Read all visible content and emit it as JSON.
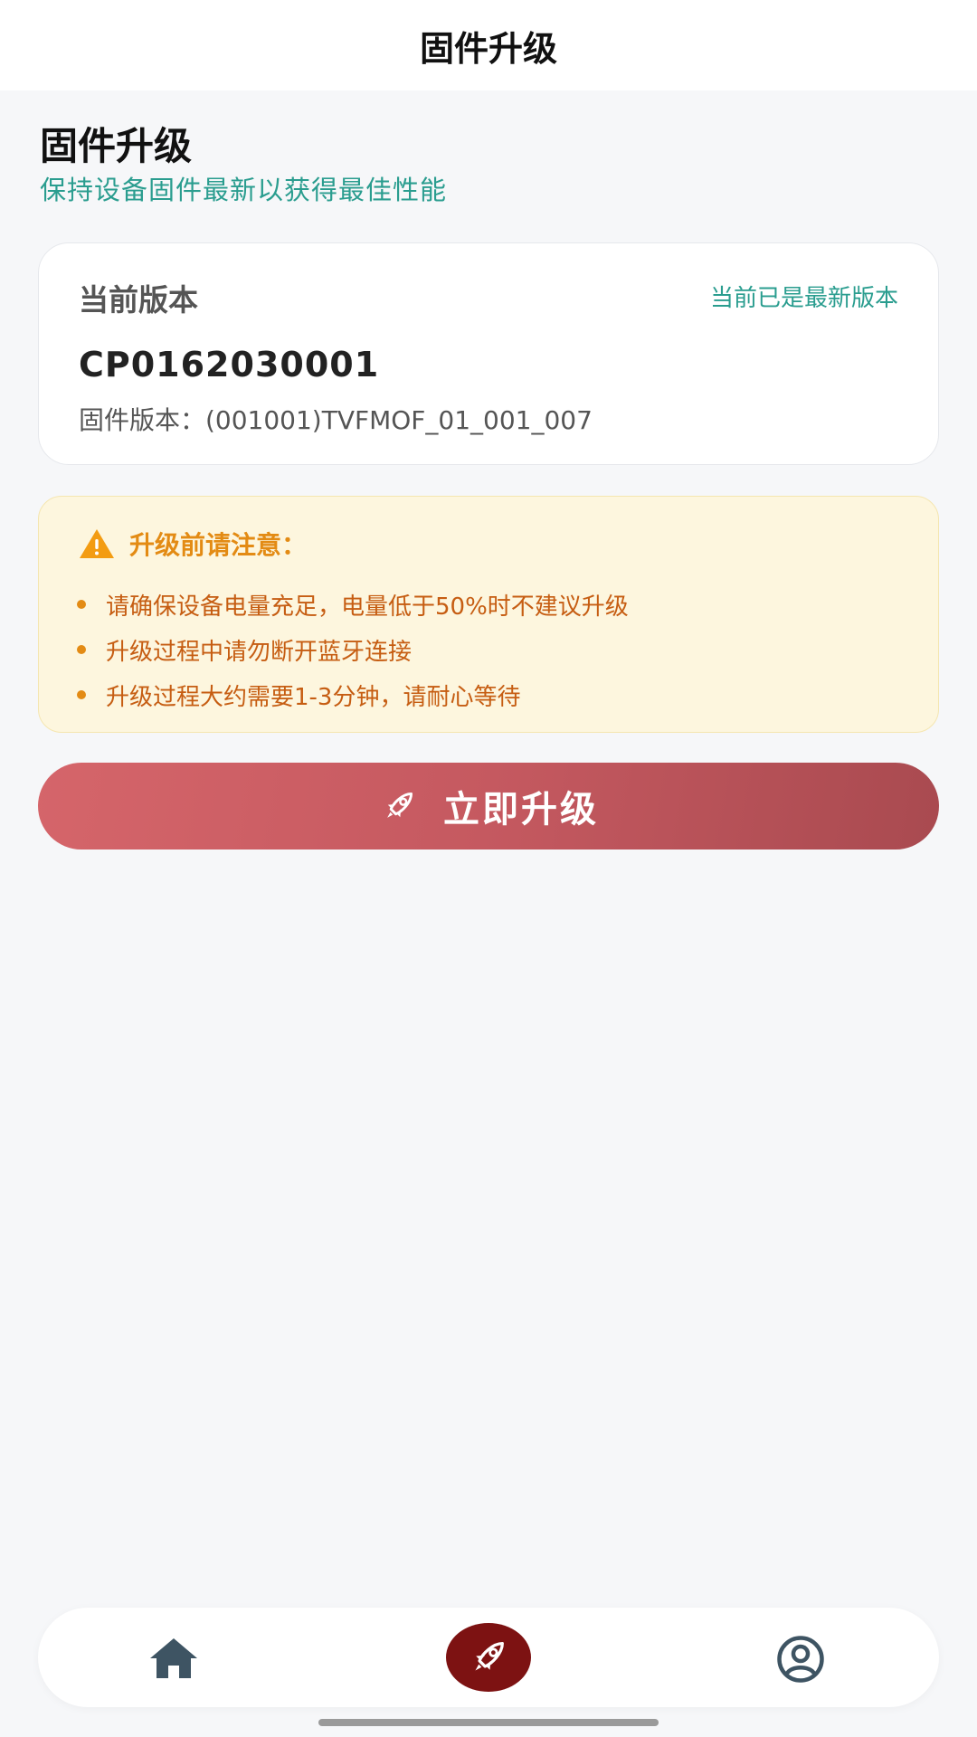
{
  "header": {
    "title": "固件升级"
  },
  "page": {
    "title": "固件升级",
    "subtitle": "保持设备固件最新以获得最佳性能"
  },
  "version_card": {
    "label": "当前版本",
    "status": "当前已是最新版本",
    "device_id": "CP0162030001",
    "firmware_version": "固件版本：(001001)TVFMOF_01_001_007"
  },
  "notice": {
    "icon": "warning-icon",
    "title": "升级前请注意：",
    "items": [
      "请确保设备电量充足，电量低于50%时不建议升级",
      "升级过程中请勿断开蓝牙连接",
      "升级过程大约需要1-3分钟，请耐心等待"
    ]
  },
  "upgrade_button": {
    "icon": "rocket-icon",
    "label": "立即升级"
  },
  "bottom_nav": {
    "items": [
      {
        "icon": "home-icon",
        "active": false
      },
      {
        "icon": "rocket-icon",
        "active": true
      },
      {
        "icon": "user-circle-icon",
        "active": false
      }
    ]
  },
  "colors": {
    "accent_teal": "#2a9d8f",
    "warning_orange": "#e38b14",
    "warning_text": "#c65d12",
    "button_gradient_start": "#d5656a",
    "button_gradient_end": "#a94a50",
    "nav_active": "#7d1212"
  }
}
